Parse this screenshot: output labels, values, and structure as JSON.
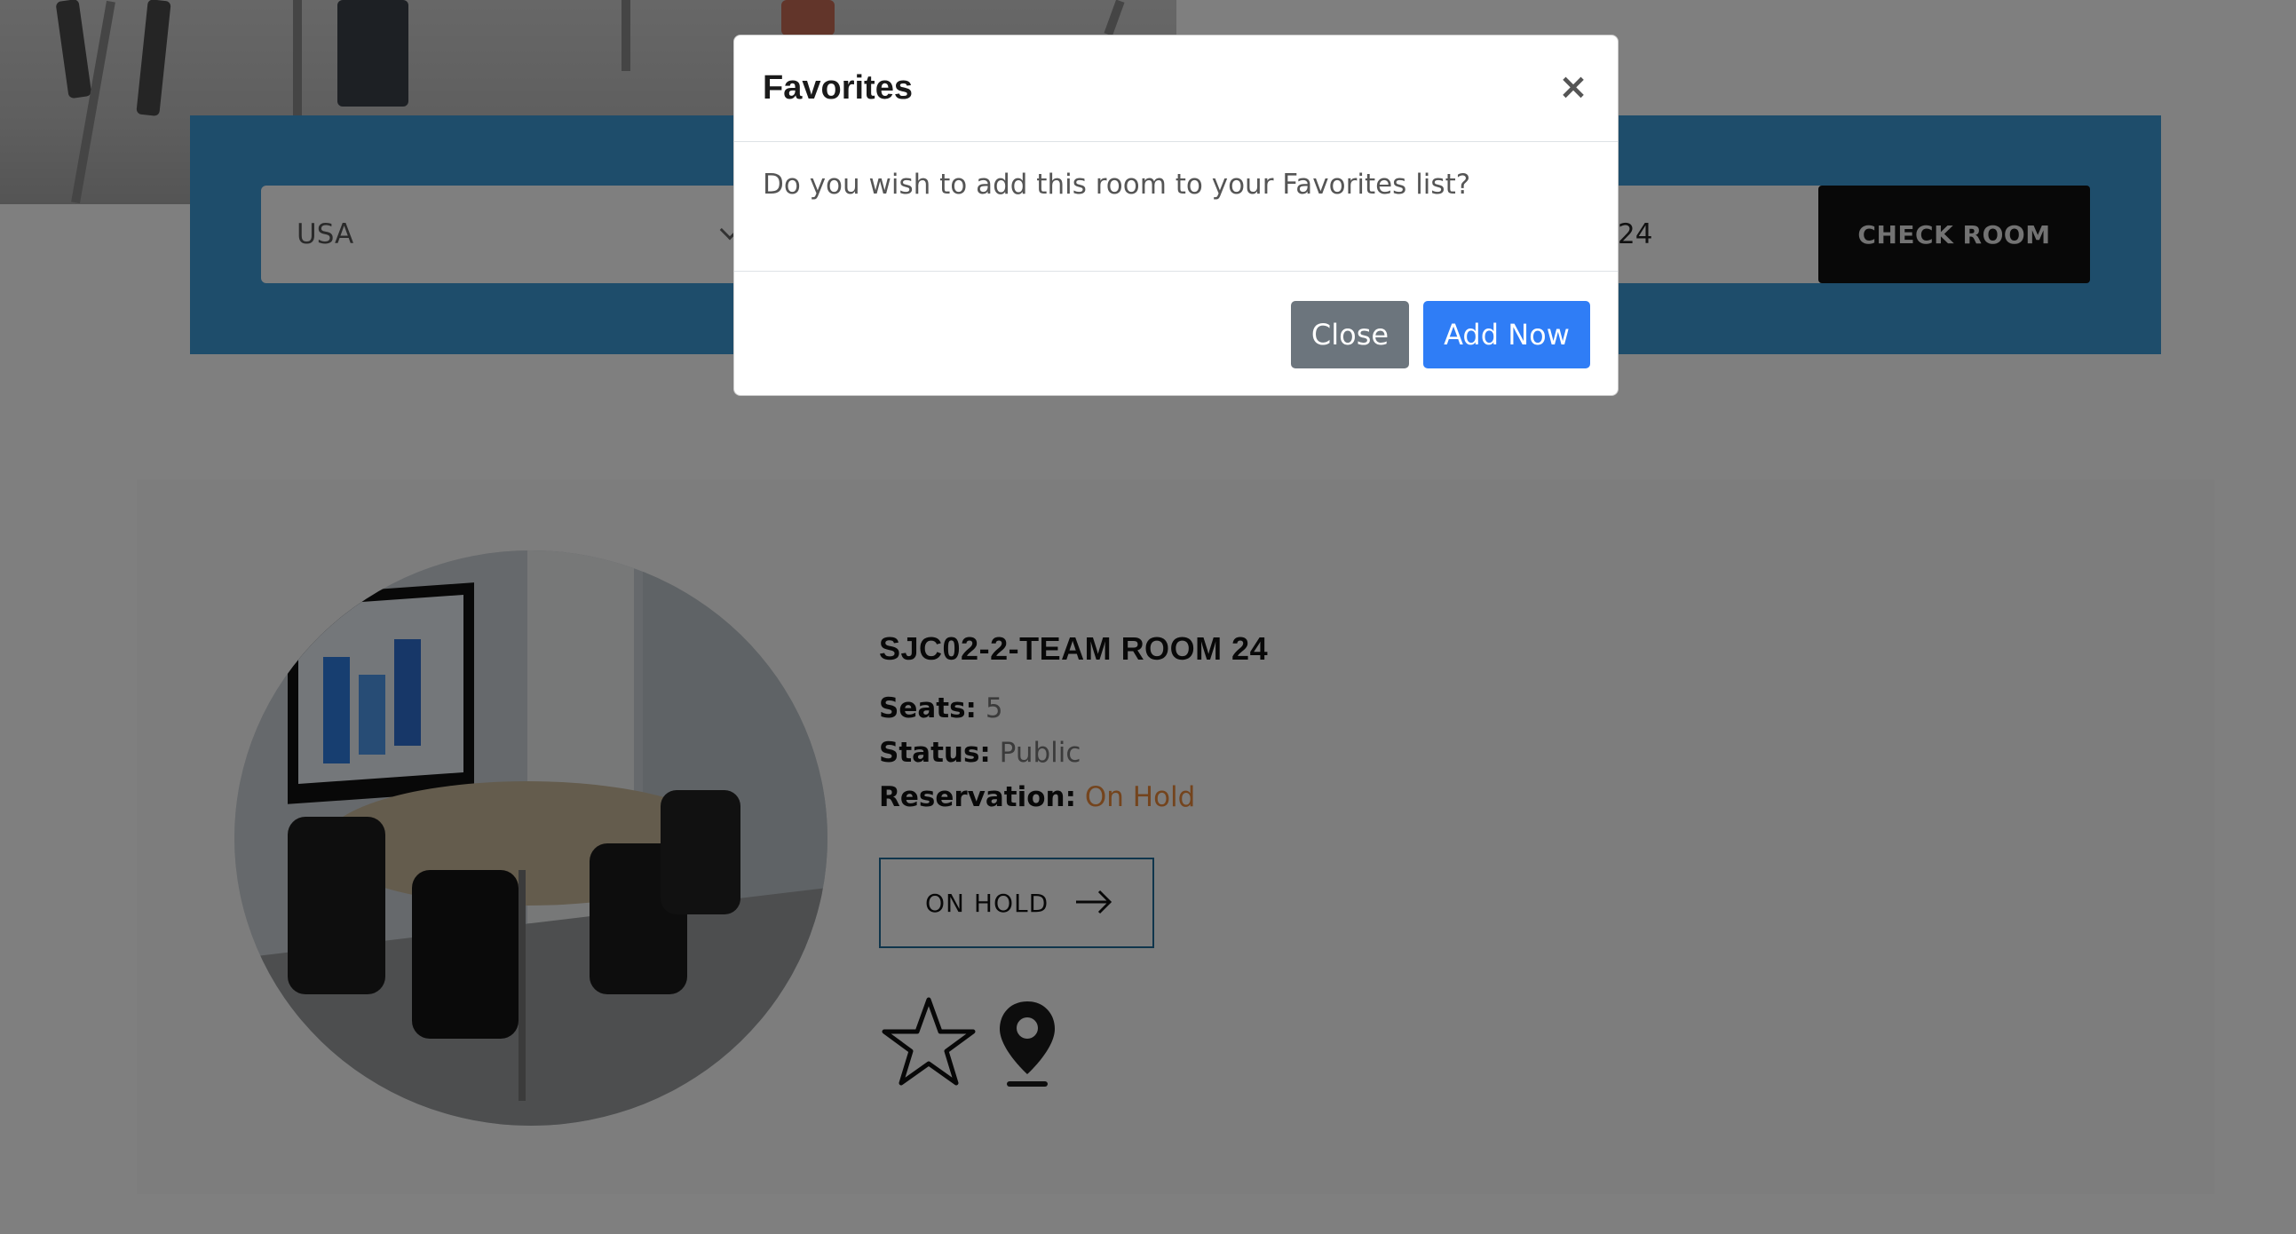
{
  "search": {
    "country_value": "USA",
    "room_value": "24",
    "check_button_label": "CHECK ROOM"
  },
  "room": {
    "title": "SJC02-2-TEAM ROOM 24",
    "seats_label": "Seats:",
    "seats_value": "5",
    "status_label": "Status:",
    "status_value": "Public",
    "reservation_label": "Reservation:",
    "reservation_value": "On Hold",
    "action_button_label": "ON HOLD",
    "icons": [
      "star-icon",
      "map-pin-icon",
      "arrow-right-icon"
    ]
  },
  "modal": {
    "title": "Favorites",
    "close_glyph": "×",
    "message": "Do you wish to add this room to your Favorites list?",
    "close_button_label": "Close",
    "add_button_label": "Add Now"
  },
  "colors": {
    "band": "#3d9ad6",
    "primary_button": "#2f7df6",
    "secondary_button": "#6c757d",
    "reservation_status": "#e8893a",
    "check_button": "#111111"
  }
}
